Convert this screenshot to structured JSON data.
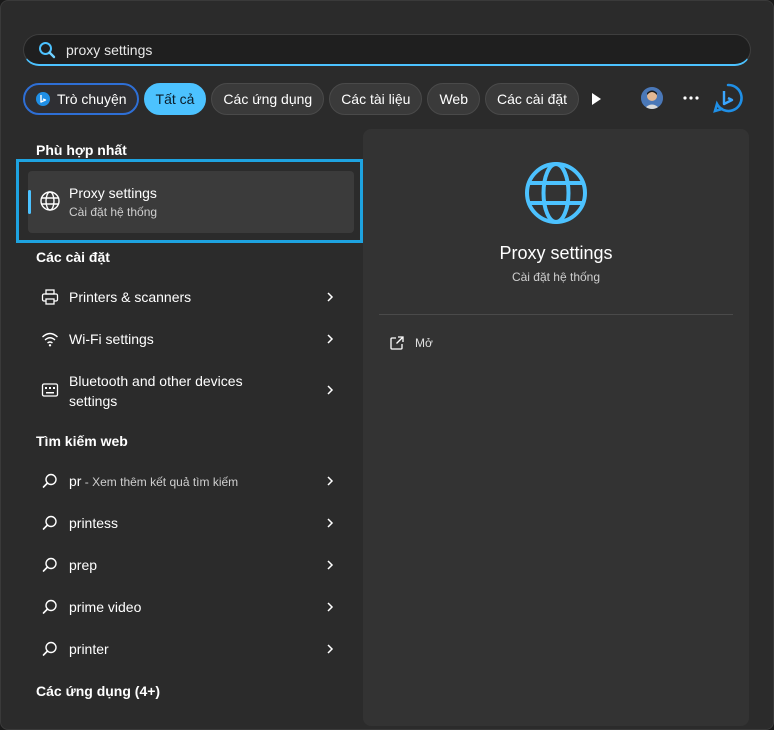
{
  "search": {
    "value": "proxy settings"
  },
  "filters": {
    "chat": "Trò chuyện",
    "all": "Tất cả",
    "apps": "Các ứng dụng",
    "documents": "Các tài liệu",
    "web": "Web",
    "settings": "Các cài đặt"
  },
  "colors": {
    "accent": "#4cc2ff",
    "highlight_frame": "#1ea3e0",
    "bing": "#1f8fe6"
  },
  "best_match": {
    "heading": "Phù hợp nhất",
    "title": "Proxy settings",
    "subtitle": "Cài đặt hệ thống",
    "icon": "globe-icon"
  },
  "settings_section": {
    "heading": "Các cài đặt",
    "items": [
      {
        "label": "Printers & scanners",
        "icon": "printer-icon"
      },
      {
        "label": "Wi-Fi settings",
        "icon": "wifi-icon"
      },
      {
        "label": "Bluetooth and other devices",
        "label2": "settings",
        "icon": "keyboard-icon"
      }
    ]
  },
  "web_section": {
    "heading": "Tìm kiếm web",
    "items": [
      {
        "label": "pr",
        "hint": " - Xem thêm kết quả tìm kiếm",
        "icon": "search-icon"
      },
      {
        "label": "printess",
        "icon": "search-icon"
      },
      {
        "label": "prep",
        "icon": "search-icon"
      },
      {
        "label": "prime video",
        "icon": "search-icon"
      },
      {
        "label": "printer",
        "icon": "search-icon"
      }
    ]
  },
  "apps_section": {
    "heading": "Các ứng dụng (4+)"
  },
  "preview": {
    "title": "Proxy settings",
    "subtitle": "Cài đặt hệ thống",
    "open_label": "Mở",
    "icon": "globe-icon"
  }
}
